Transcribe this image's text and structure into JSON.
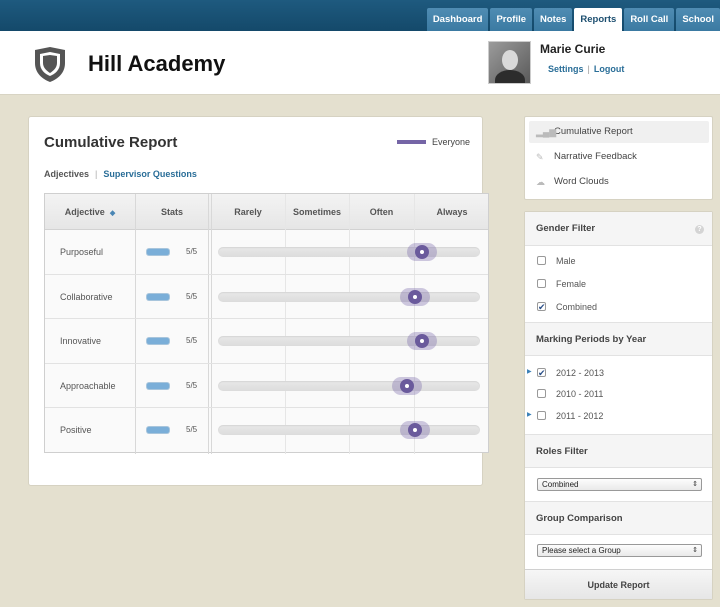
{
  "nav": {
    "tabs": [
      {
        "label": "Dashboard"
      },
      {
        "label": "Profile"
      },
      {
        "label": "Notes"
      },
      {
        "label": "Reports"
      },
      {
        "label": "Roll Call"
      },
      {
        "label": "School"
      }
    ],
    "active": "Reports"
  },
  "header": {
    "brand": "Hill Academy",
    "user_name": "Marie Curie",
    "settings_label": "Settings",
    "logout_label": "Logout",
    "separator": "|"
  },
  "report": {
    "title": "Cumulative Report",
    "legend_label": "Everyone",
    "legend_color": "#7565a6",
    "subtab_current": "Adjectives",
    "subtab_link": "Supervisor Questions",
    "subtab_separator": "|",
    "columns": {
      "adjective": "Adjective",
      "stats": "Stats",
      "rarely": "Rarely",
      "sometimes": "Sometimes",
      "often": "Often",
      "always": "Always"
    },
    "rows": [
      {
        "label": "Purposeful",
        "stat": "5/5",
        "score": 0.78
      },
      {
        "label": "Collaborative",
        "stat": "5/5",
        "score": 0.75
      },
      {
        "label": "Innovative",
        "stat": "5/5",
        "score": 0.78
      },
      {
        "label": "Approachable",
        "stat": "5/5",
        "score": 0.72
      },
      {
        "label": "Positive",
        "stat": "5/5",
        "score": 0.75
      }
    ]
  },
  "sidebar": {
    "views": [
      {
        "label": "Narrative Feedback"
      },
      {
        "label": "Word Clouds"
      }
    ],
    "active_view": "Cumulative Report",
    "gender_filter": {
      "title": "Gender Filter",
      "options": [
        {
          "label": "Male",
          "checked": false
        },
        {
          "label": "Female",
          "checked": false
        },
        {
          "label": "Combined",
          "checked": true
        }
      ]
    },
    "marking_periods": {
      "title": "Marking Periods by Year",
      "options": [
        {
          "label": "2012 - 2013",
          "checked": true
        },
        {
          "label": "2010 - 2011",
          "checked": false
        },
        {
          "label": "2011 - 2012",
          "checked": false
        }
      ]
    },
    "roles_filter": {
      "title": "Roles Filter",
      "selected": "Combined"
    },
    "group_comparison": {
      "title": "Group Comparison",
      "selected": "Please select a Group"
    },
    "update_label": "Update Report",
    "help_glyph": "?"
  }
}
